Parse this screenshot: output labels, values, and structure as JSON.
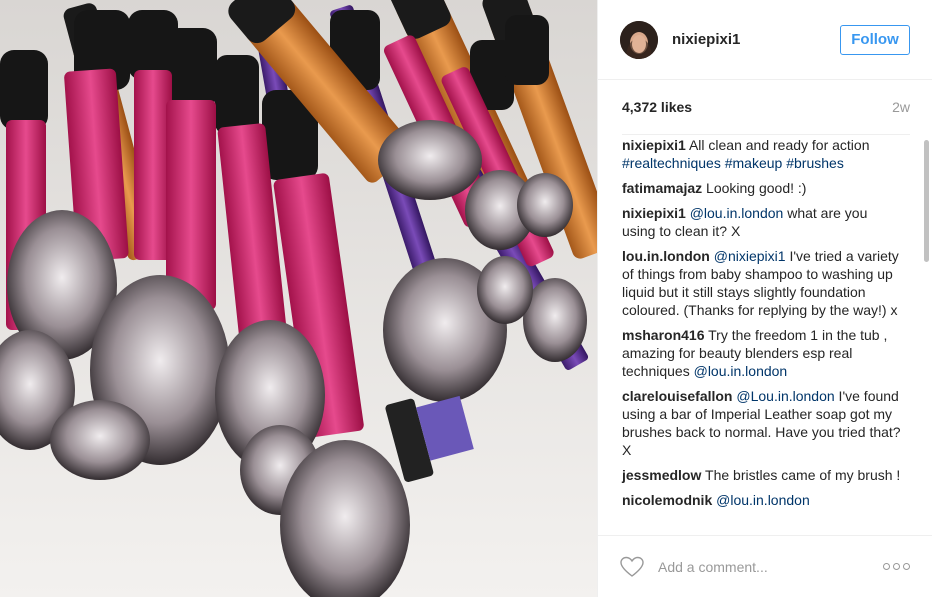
{
  "post": {
    "photo_alt": "",
    "author": {
      "username": "nixiepixi1",
      "avatar_icon": "avatar-icon"
    },
    "follow_label": "Follow",
    "likes": "4,372 likes",
    "age": "2w",
    "comments": [
      {
        "user": "nixiepixi1",
        "parts": [
          {
            "text": "All clean and ready for action ",
            "type": "text"
          },
          {
            "text": "#realtechniques #makeup #brushes",
            "type": "link"
          }
        ]
      },
      {
        "user": "fatimamajaz",
        "parts": [
          {
            "text": "Looking good! :)",
            "type": "text"
          }
        ]
      },
      {
        "user": "nixiepixi1",
        "parts": [
          {
            "text": "@lou.in.london",
            "type": "link"
          },
          {
            "text": " what are you using to clean it? X",
            "type": "text"
          }
        ]
      },
      {
        "user": "lou.in.london",
        "parts": [
          {
            "text": "@nixiepixi1",
            "type": "link"
          },
          {
            "text": " I've tried a variety of things from baby shampoo to washing up liquid but it still stays slightly foundation coloured. (Thanks for replying by the way!) x",
            "type": "text"
          }
        ]
      },
      {
        "user": "msharon416",
        "parts": [
          {
            "text": "Try the freedom 1 in the tub , amazing for beauty blenders esp real techniques ",
            "type": "text"
          },
          {
            "text": "@lou.in.london",
            "type": "link"
          }
        ]
      },
      {
        "user": "clarelouisefallon",
        "parts": [
          {
            "text": "@Lou.in.london",
            "type": "link"
          },
          {
            "text": " I've found using a bar of Imperial Leather soap got my brushes back to normal. Have you tried that? X",
            "type": "text"
          }
        ]
      },
      {
        "user": "jessmedlow",
        "parts": [
          {
            "text": "The bristles came of my brush !",
            "type": "text"
          }
        ]
      },
      {
        "user": "nicolemodnik",
        "parts": [
          {
            "text": "@lou.in.london",
            "type": "link"
          },
          {
            "text": " ",
            "type": "text"
          }
        ]
      }
    ],
    "comment_placeholder": "Add a comment...",
    "icons": {
      "like": "heart-icon",
      "more": "more-options-icon"
    },
    "colors": {
      "follow": "#3897f0",
      "link": "#003569",
      "muted": "#999999"
    }
  }
}
